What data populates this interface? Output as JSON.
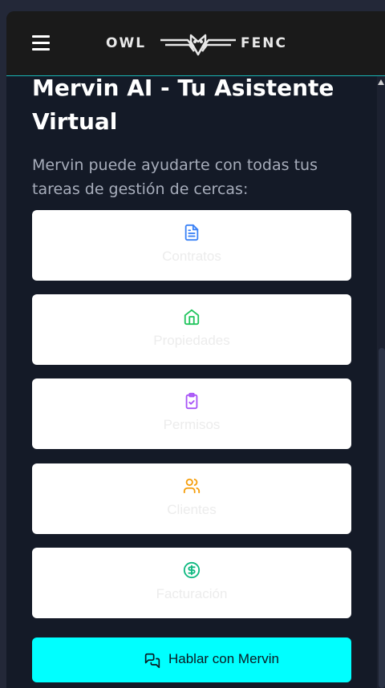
{
  "header": {
    "logo_left": "OWL",
    "logo_right": "FENC"
  },
  "main": {
    "title": "Mervin AI - Tu Asistente Virtual",
    "subtitle": "Mervin puede ayudarte con todas tus tareas de gestión de cercas:",
    "cards": [
      {
        "label": "Contratos",
        "icon": "document-icon",
        "color": "#3b82f6"
      },
      {
        "label": "Propiedades",
        "icon": "home-icon",
        "color": "#22c55e"
      },
      {
        "label": "Permisos",
        "icon": "clipboard-check-icon",
        "color": "#a855f7"
      },
      {
        "label": "Clientes",
        "icon": "users-icon",
        "color": "#f59e0b"
      },
      {
        "label": "Facturación",
        "icon": "dollar-circle-icon",
        "color": "#10b981"
      }
    ],
    "cta": {
      "label": "Hablar con Mervin",
      "icon": "chat-icon"
    }
  },
  "colors": {
    "accent": "#00ffff",
    "header_bg": "#1a1a1a",
    "content_bg": "#141a27"
  }
}
